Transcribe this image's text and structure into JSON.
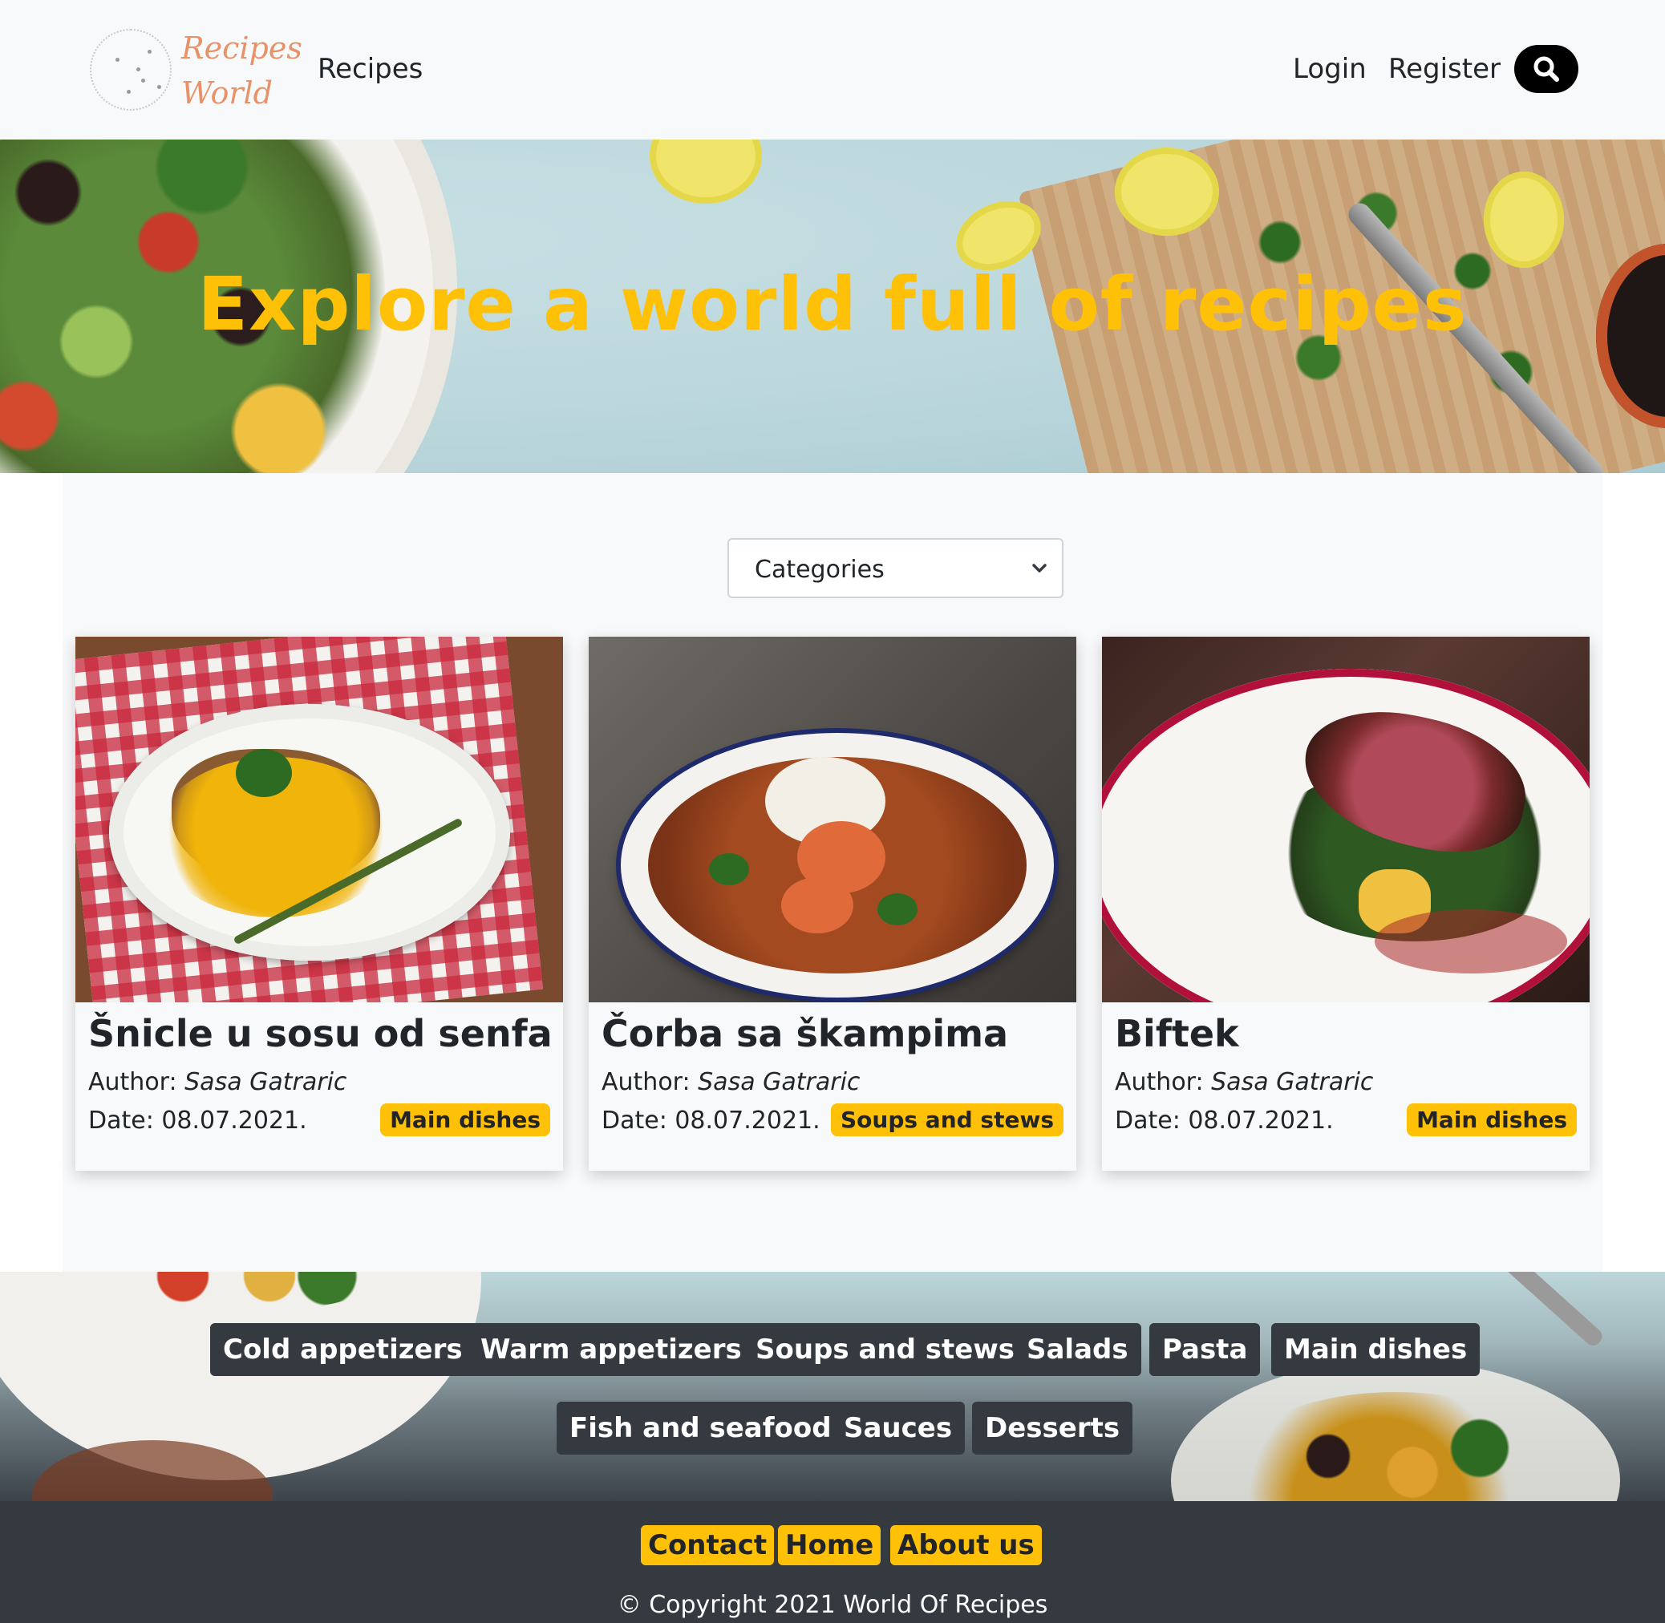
{
  "navbar": {
    "logo_line1": "Recipes",
    "logo_line2": "World",
    "recipes_link": "Recipes",
    "login_link": "Login",
    "register_link": "Register"
  },
  "hero": {
    "title": "Explore a world full of recipes"
  },
  "filter": {
    "categories_selected": "Categories"
  },
  "cards": [
    {
      "title": "Šnicle u sosu od senfa",
      "author_label": "Author:",
      "author": "Sasa Gatraric",
      "date_label": "Date: 08.07.2021.",
      "category": "Main dishes"
    },
    {
      "title": "Čorba sa škampima",
      "author_label": "Author:",
      "author": "Sasa Gatraric",
      "date_label": "Date: 08.07.2021.",
      "category": "Soups and stews"
    },
    {
      "title": "Biftek",
      "author_label": "Author:",
      "author": "Sasa Gatraric",
      "date_label": "Date: 08.07.2021.",
      "category": "Main dishes"
    }
  ],
  "category_buttons": [
    "Cold appetizers",
    "Warm appetizers",
    "Soups and stews",
    "Salads",
    "Pasta",
    "Main dishes",
    "Fish and seafood",
    "Sauces",
    "Desserts"
  ],
  "footer": {
    "contact": "Contact",
    "home": "Home",
    "about": "About us",
    "copyright": "© Copyright 2021 World Of Recipes"
  },
  "colors": {
    "accent": "#ffc107",
    "dark": "#343a40",
    "light_bg": "#f8f9fa"
  },
  "icons": {
    "search": "search-icon",
    "select": "chevron-down-icon"
  }
}
